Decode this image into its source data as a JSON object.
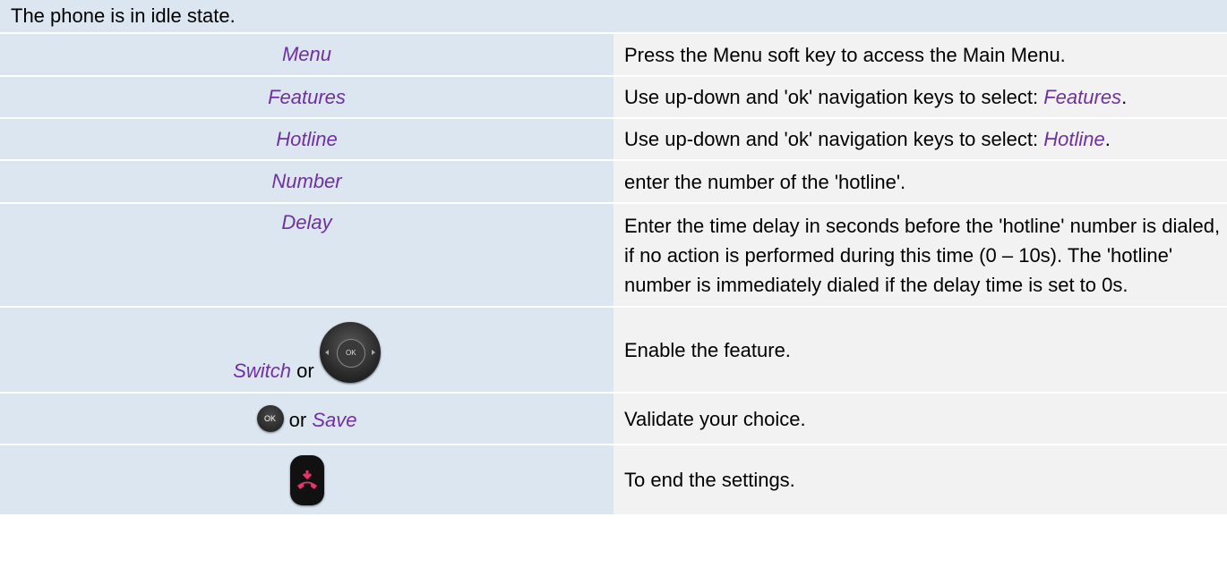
{
  "header": "The phone is in idle state.",
  "rows": [
    {
      "key": "Menu",
      "desc": "Press the Menu soft key to access the Main Menu."
    },
    {
      "key": "Features",
      "desc_prefix": "Use up-down and 'ok' navigation keys to select: ",
      "desc_key": "Features",
      "desc_suffix": "."
    },
    {
      "key": "Hotline",
      "desc_prefix": "Use up-down and 'ok' navigation keys to select: ",
      "desc_key": "Hotline",
      "desc_suffix": "."
    },
    {
      "key": "Number",
      "desc": "enter the number of the 'hotline'."
    },
    {
      "key": "Delay",
      "desc": "Enter the time delay in seconds before the 'hotline' number is dialed, if no action is performed during this time (0 – 10s). The 'hotline' number is immediately dialed if the delay time is set to 0s."
    },
    {
      "key": "Switch",
      "connector": "or",
      "icon": "navigation-pad-icon",
      "icon_text": "OK",
      "desc": "Enable the feature."
    },
    {
      "icon": "ok-button-icon",
      "icon_text": "OK",
      "connector": "or",
      "key": "Save",
      "desc": "Validate your choice."
    },
    {
      "icon": "end-call-button-icon",
      "desc": "To end the settings."
    }
  ],
  "colors": {
    "key_text": "#7030a0",
    "left_cell": "#dce6f1",
    "right_cell": "#f2f2f2",
    "end_call_red": "#e8336b"
  }
}
